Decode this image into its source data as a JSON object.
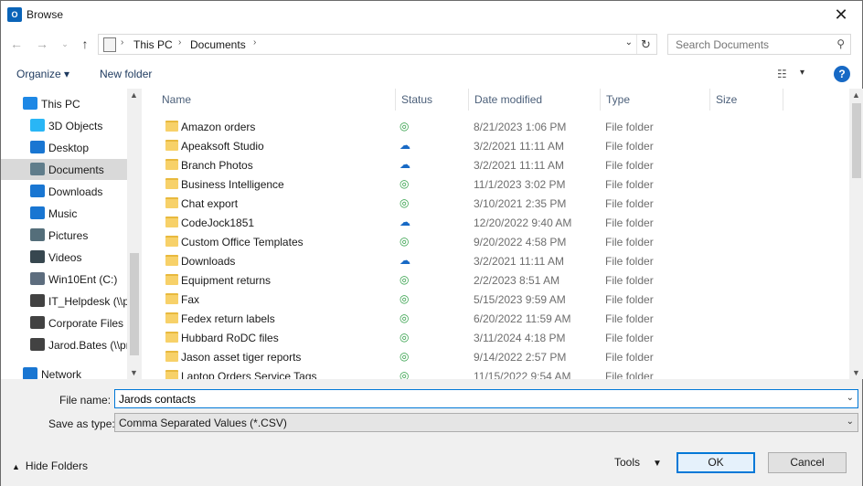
{
  "window": {
    "title": "Browse",
    "app_icon": "O"
  },
  "address": {
    "crumbs": [
      "This PC",
      "Documents"
    ],
    "search_placeholder": "Search Documents"
  },
  "commands": {
    "organize": "Organize ▾",
    "new_folder": "New folder"
  },
  "nav": {
    "items": [
      {
        "label": "This PC",
        "icon": "computer-icon",
        "color": "#1e88e5",
        "indent": 1,
        "selected": false
      },
      {
        "label": "3D Objects",
        "icon": "cube-icon",
        "color": "#29b6f6",
        "indent": 2,
        "selected": false
      },
      {
        "label": "Desktop",
        "icon": "desktop-icon",
        "color": "#1976d2",
        "indent": 2,
        "selected": false
      },
      {
        "label": "Documents",
        "icon": "document-icon",
        "color": "#607d8b",
        "indent": 2,
        "selected": true
      },
      {
        "label": "Downloads",
        "icon": "download-icon",
        "color": "#1976d2",
        "indent": 2,
        "selected": false
      },
      {
        "label": "Music",
        "icon": "music-icon",
        "color": "#1976d2",
        "indent": 2,
        "selected": false
      },
      {
        "label": "Pictures",
        "icon": "picture-icon",
        "color": "#546e7a",
        "indent": 2,
        "selected": false
      },
      {
        "label": "Videos",
        "icon": "video-icon",
        "color": "#37474f",
        "indent": 2,
        "selected": false
      },
      {
        "label": "Win10Ent (C:)",
        "icon": "drive-icon",
        "color": "#5d6d7e",
        "indent": 2,
        "selected": false
      },
      {
        "label": "IT_Helpdesk (\\\\p",
        "icon": "network-drive-icon",
        "color": "#424242",
        "indent": 2,
        "selected": false
      },
      {
        "label": "Corporate Files (",
        "icon": "network-drive-icon",
        "color": "#424242",
        "indent": 2,
        "selected": false
      },
      {
        "label": "Jarod.Bates (\\\\pr",
        "icon": "network-drive-icon",
        "color": "#424242",
        "indent": 2,
        "selected": false
      },
      {
        "label": "Network",
        "icon": "network-icon",
        "color": "#1976d2",
        "indent": 1,
        "selected": false
      }
    ]
  },
  "columns": [
    "Name",
    "Status",
    "Date modified",
    "Type",
    "Size"
  ],
  "files": [
    {
      "name": "Amazon orders",
      "status": "ok",
      "date": "8/21/2023 1:06 PM",
      "type": "File folder"
    },
    {
      "name": "Apeaksoft Studio",
      "status": "cloud",
      "date": "3/2/2021 11:11 AM",
      "type": "File folder"
    },
    {
      "name": "Branch Photos",
      "status": "cloud",
      "date": "3/2/2021 11:11 AM",
      "type": "File folder"
    },
    {
      "name": "Business Intelligence",
      "status": "ok",
      "date": "11/1/2023 3:02 PM",
      "type": "File folder"
    },
    {
      "name": "Chat export",
      "status": "ok",
      "date": "3/10/2021 2:35 PM",
      "type": "File folder"
    },
    {
      "name": "CodeJock1851",
      "status": "cloud",
      "date": "12/20/2022 9:40 AM",
      "type": "File folder"
    },
    {
      "name": "Custom Office Templates",
      "status": "ok",
      "date": "9/20/2022 4:58 PM",
      "type": "File folder"
    },
    {
      "name": "Downloads",
      "status": "cloud",
      "date": "3/2/2021 11:11 AM",
      "type": "File folder"
    },
    {
      "name": "Equipment returns",
      "status": "ok",
      "date": "2/2/2023 8:51 AM",
      "type": "File folder"
    },
    {
      "name": "Fax",
      "status": "ok",
      "date": "5/15/2023 9:59 AM",
      "type": "File folder"
    },
    {
      "name": "Fedex return labels",
      "status": "ok",
      "date": "6/20/2022 11:59 AM",
      "type": "File folder"
    },
    {
      "name": "Hubbard RoDC files",
      "status": "ok",
      "date": "3/11/2024 4:18 PM",
      "type": "File folder"
    },
    {
      "name": "Jason asset tiger reports",
      "status": "ok",
      "date": "9/14/2022 2:57 PM",
      "type": "File folder"
    },
    {
      "name": "Laptop Orders Service Tags",
      "status": "ok",
      "date": "11/15/2022 9:54 AM",
      "type": "File folder"
    }
  ],
  "form": {
    "file_name_label": "File name:",
    "file_name_value": "Jarods contacts",
    "save_type_label": "Save as type:",
    "save_type_value": "Comma Separated Values (*.CSV)"
  },
  "footer": {
    "hide_folders": "Hide Folders",
    "tools": "Tools",
    "ok": "OK",
    "cancel": "Cancel"
  },
  "colors": {
    "accent": "#0078d7",
    "ok_status": "#2e9e45",
    "cloud_status": "#1769c5",
    "folder": "#f7d169"
  }
}
